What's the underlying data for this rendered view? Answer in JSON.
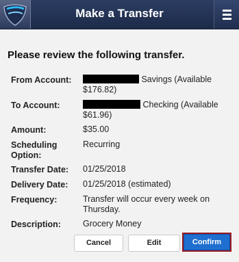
{
  "header": {
    "title": "Make a Transfer",
    "logo_icon": "shield-logo-icon",
    "menu_icon": "hamburger-menu-icon"
  },
  "review": {
    "prompt": "Please review the following transfer.",
    "rows": [
      {
        "label": "From Account:",
        "value_suffix": " Savings (Available",
        "value_line2": "$176.82)"
      },
      {
        "label": "To Account:",
        "value_suffix": " Checking (Available",
        "value_line2": "$61.96)"
      },
      {
        "label": "Amount:",
        "value": "$35.00"
      },
      {
        "label": "Scheduling",
        "label_line2": "Option:",
        "value": "Recurring"
      },
      {
        "label": "Transfer Date:",
        "value": "01/25/2018"
      },
      {
        "label": "Delivery Date:",
        "value": "01/25/2018 (estimated)"
      },
      {
        "label": "Frequency:",
        "value": "Transfer will occur every week on",
        "value_line2": "Thursday."
      },
      {
        "label": "Description:",
        "value": "Grocery Money"
      }
    ]
  },
  "actions": {
    "cancel": "Cancel",
    "edit": "Edit",
    "confirm": "Confirm"
  },
  "colors": {
    "header": "#1d2b49",
    "confirm": "#1f6fd0",
    "confirm_outline": "#9a1b23"
  }
}
